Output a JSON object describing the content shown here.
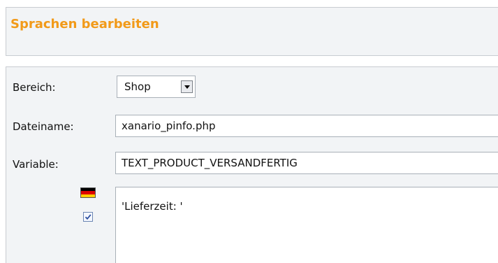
{
  "header": {
    "title": "Sprachen bearbeiten"
  },
  "form": {
    "bereich": {
      "label": "Bereich:",
      "selected": "Shop"
    },
    "dateiname": {
      "label": "Dateiname:",
      "value": "xanario_pinfo.php"
    },
    "variable": {
      "label": "Variable:",
      "value": "TEXT_PRODUCT_VERSANDFERTIG"
    },
    "translation": {
      "language_icon": "german-flag-icon",
      "enabled": true,
      "value": "'Lieferzeit: '"
    }
  },
  "colors": {
    "title": "#f29a19",
    "panel_bg": "#f2f4f6",
    "border": "#c8ccd1",
    "input_border": "#a9b0b8"
  }
}
